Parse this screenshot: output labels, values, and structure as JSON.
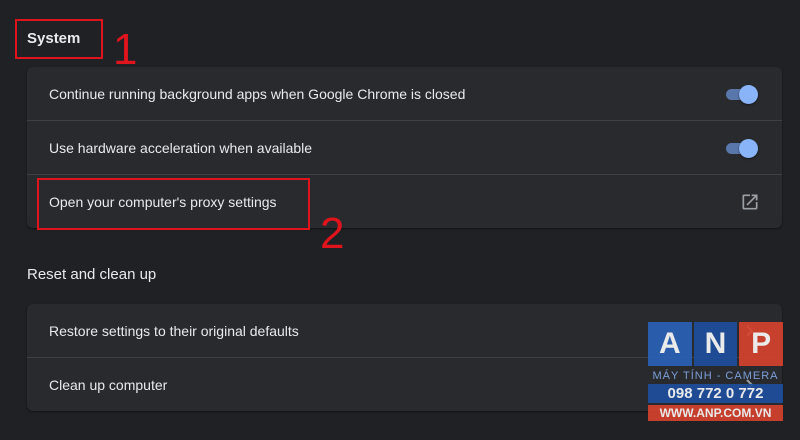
{
  "system": {
    "title": "System",
    "rows": [
      {
        "label": "Continue running background apps when Google Chrome is closed",
        "control": "toggle",
        "enabled": true
      },
      {
        "label": "Use hardware acceleration when available",
        "control": "toggle",
        "enabled": true
      },
      {
        "label": "Open your computer's proxy settings",
        "control": "external-link-icon"
      }
    ]
  },
  "reset": {
    "title": "Reset and clean up",
    "rows": [
      {
        "label": "Restore settings to their original defaults",
        "control": "arrow-right-icon"
      },
      {
        "label": "Clean up computer",
        "control": "arrow-right-icon"
      }
    ]
  },
  "annotations": {
    "number_1": "1",
    "number_2": "2",
    "color": "#e0141c"
  },
  "watermark": {
    "letters": [
      "A",
      "N",
      "P"
    ],
    "tagline": "MÁY TÍNH - CAMERA",
    "phone": "098 772 0 772",
    "url": "WWW.ANP.COM.VN"
  },
  "colors": {
    "background": "#202124",
    "card": "#292a2d",
    "toggle_on": "#8ab4f8"
  }
}
